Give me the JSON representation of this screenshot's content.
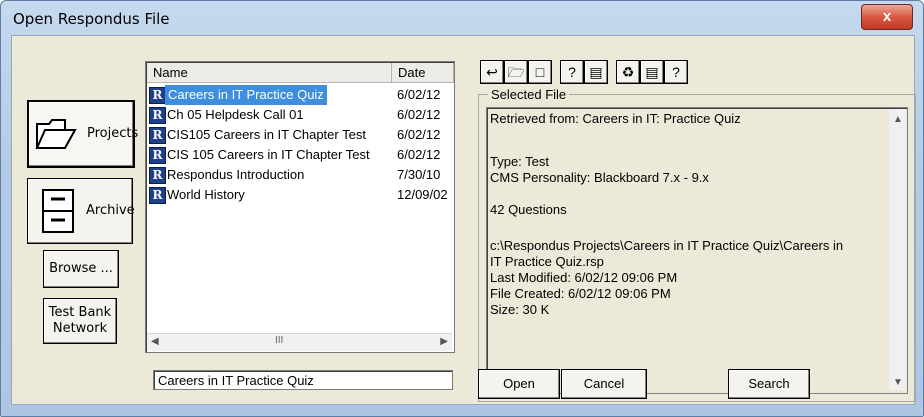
{
  "window": {
    "title": "Open Respondus File",
    "close_label": "x"
  },
  "sidebar": {
    "projects_label": "Projects",
    "archive_label": "Archive",
    "browse_label": "Browse ...",
    "test_bank_line1": "Test Bank",
    "test_bank_line2": "Network"
  },
  "file_list": {
    "columns": [
      "Name",
      "Date"
    ],
    "rows": [
      {
        "name": "Careers in IT Practice Quiz",
        "date": "6/02/12",
        "selected": true
      },
      {
        "name": "Ch 05 Helpdesk Call 01",
        "date": "6/02/12",
        "selected": false
      },
      {
        "name": "CIS105 Careers in IT Chapter Test",
        "date": "6/02/12",
        "selected": false
      },
      {
        "name": "CIS 105 Careers in IT Chapter Test",
        "date": "6/02/12",
        "selected": false
      },
      {
        "name": "Respondus Introduction",
        "date": "7/30/10",
        "selected": false
      },
      {
        "name": "World History",
        "date": "12/09/02",
        "selected": false
      }
    ],
    "scroll_thumb": "III"
  },
  "selected_file": {
    "group_label": "Selected File",
    "lines": [
      "Retrieved from: Careers in IT: Practice Quiz",
      "",
      "Type: Test",
      "CMS Personality: Blackboard  7.x - 9.x",
      "",
      "42 Questions",
      "",
      "c:\\Respondus Projects\\Careers in IT Practice Quiz\\Careers in",
      "IT Practice Quiz.rsp",
      "Last Modified: 6/02/12  09:06 PM",
      "File Created: 6/02/12  09:06 PM",
      "Size: 30 K"
    ]
  },
  "toolbar": {
    "icons": [
      "up-folder-icon",
      "new-folder-icon",
      "new-file-icon",
      "help-properties-icon",
      "list-view-icon",
      "recycle-icon",
      "archive-icon",
      "question-icon"
    ]
  },
  "footer": {
    "filename_value": "Careers in IT Practice Quiz",
    "open_label": "Open",
    "cancel_label": "Cancel",
    "search_label": "Search"
  },
  "colors": {
    "selection": "#3e8ee0",
    "dialog_bg": "#ece9d8",
    "close_button": "#d9583f"
  }
}
